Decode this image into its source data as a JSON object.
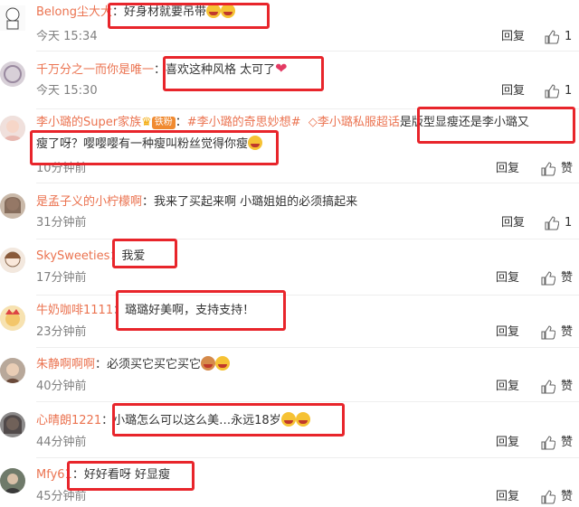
{
  "comments": [
    {
      "user": "Belong尘大大",
      "text": "好身材就要吊带",
      "time": "今天 15:34",
      "reply": "回复",
      "like": "1"
    },
    {
      "user": "千万分之一而你是唯一",
      "text": "喜欢这种风格  太可了",
      "time": "今天 15:30",
      "reply": "回复",
      "like": "1"
    },
    {
      "user": "李小璐的Super家族",
      "badge": "铁粉",
      "tags": [
        "#李小璐的奇思妙想#",
        "李小璐私服超话"
      ],
      "text": "是版型显瘦还是李小璐又",
      "text2": "瘦了呀？嘤嘤嘤有一种瘦叫粉丝觉得你瘦",
      "time": "10分钟前",
      "reply": "回复",
      "like": "赞"
    },
    {
      "user": "是孟子义的小柠檬啊",
      "text": "我来了买起来啊 小璐姐姐的必须搞起来",
      "time": "31分钟前",
      "reply": "回复",
      "like": "1"
    },
    {
      "user": "SkySweeties",
      "text": "我爱",
      "time": "17分钟前",
      "reply": "回复",
      "like": "赞"
    },
    {
      "user": "牛奶咖啡1111",
      "text": "璐璐好美啊，支持支持！",
      "time": "23分钟前",
      "reply": "回复",
      "like": "赞"
    },
    {
      "user": "朱静啊啊啊",
      "text": "必须买它买它买它",
      "time": "40分钟前",
      "reply": "回复",
      "like": "赞"
    },
    {
      "user": "心晴朗1221",
      "text": "小璐怎么可以这么美…永远18岁",
      "time": "44分钟前",
      "reply": "回复",
      "like": "赞"
    },
    {
      "user": "Mfy61",
      "text": "好好看呀  好显瘦",
      "time": "45分钟前",
      "reply": "回复",
      "like": "赞"
    }
  ],
  "colors": {
    "username": "#eb7350",
    "highlight": "#e8252b",
    "time": "#808080"
  },
  "icons": {
    "like": "thumbs-up-icon",
    "emoji": "laugh-emoji-icon"
  }
}
